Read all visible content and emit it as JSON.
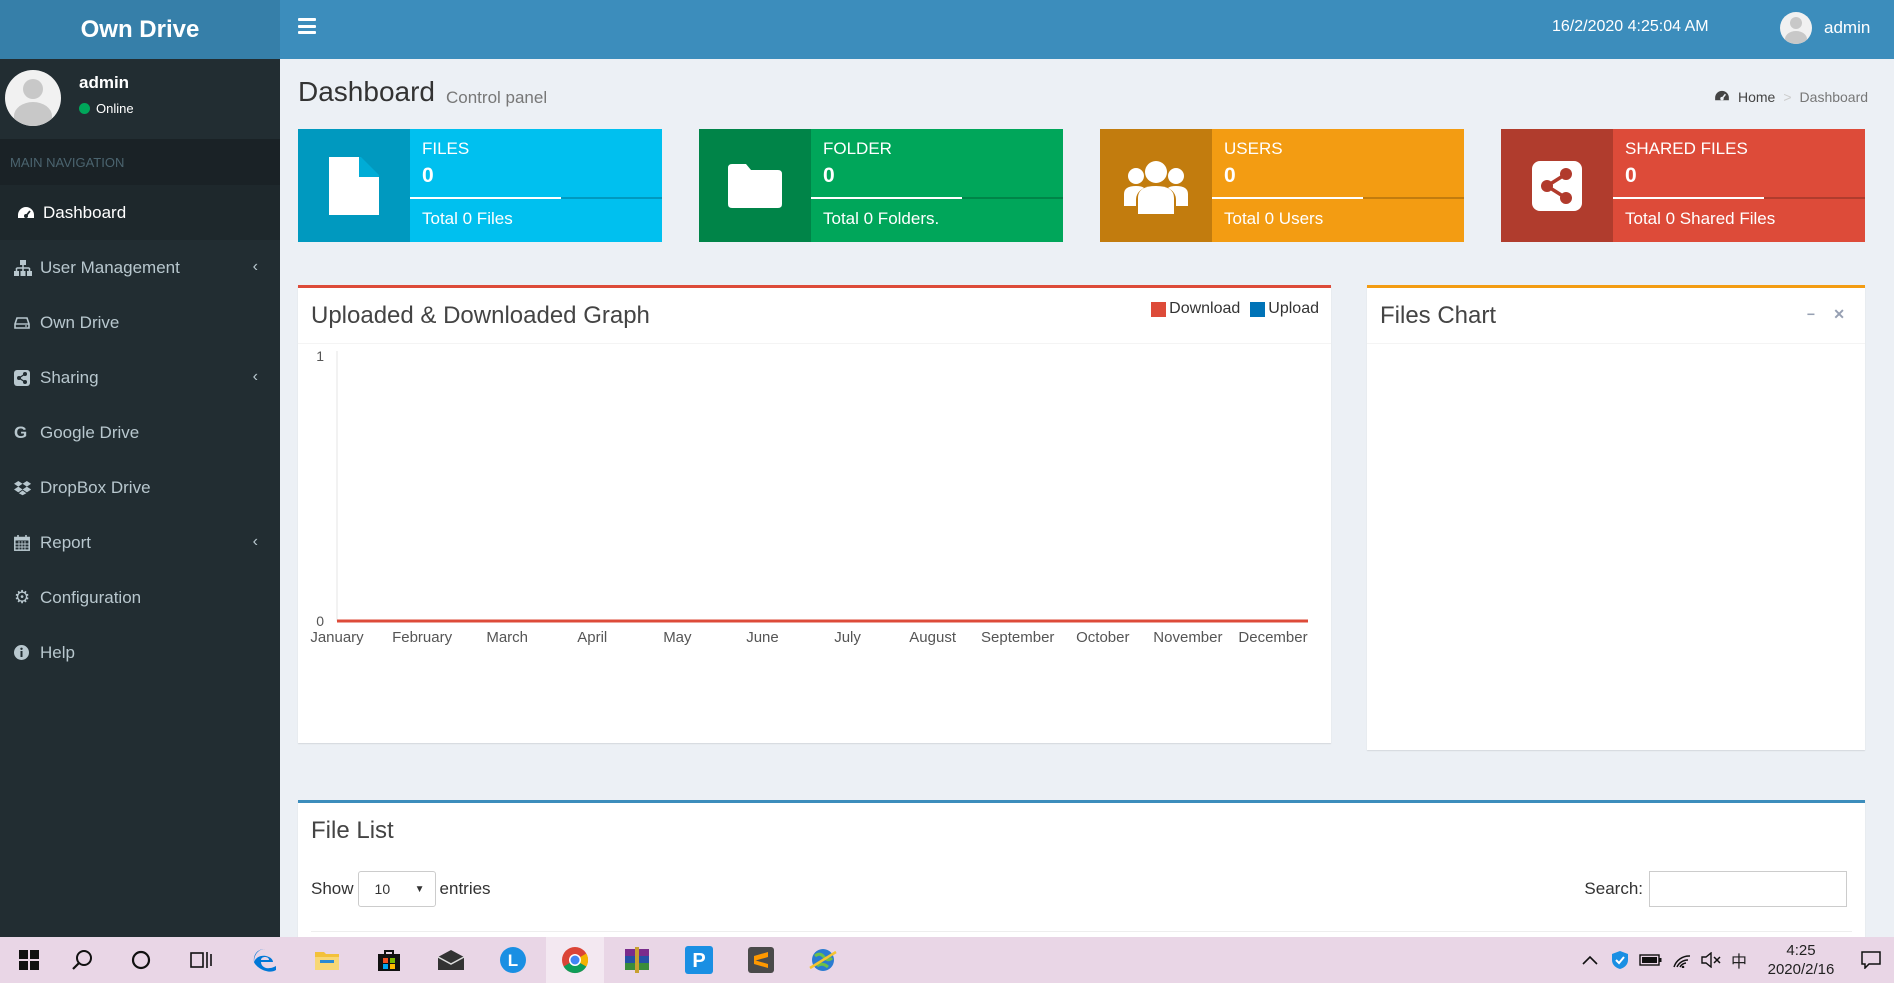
{
  "app": {
    "logo": "Own Drive"
  },
  "header": {
    "datetime": "16/2/2020 4:25:04 AM",
    "user": "admin"
  },
  "sidebar": {
    "user_name": "admin",
    "status": "Online",
    "nav_header": "MAIN NAVIGATION",
    "items": [
      {
        "label": "Dashboard",
        "icon": "dashboard-icon"
      },
      {
        "label": "User Management",
        "icon": "sitemap-icon"
      },
      {
        "label": "Own Drive",
        "icon": "hdd-icon"
      },
      {
        "label": "Sharing",
        "icon": "share-square-icon"
      },
      {
        "label": "Google Drive",
        "icon": "google-icon"
      },
      {
        "label": "DropBox Drive",
        "icon": "dropbox-icon"
      },
      {
        "label": "Report",
        "icon": "calendar-icon"
      },
      {
        "label": "Configuration",
        "icon": "gear-icon"
      },
      {
        "label": "Help",
        "icon": "info-circle-icon"
      }
    ]
  },
  "page": {
    "title": "Dashboard",
    "subtitle": "Control panel"
  },
  "breadcrumb": {
    "home": "Home",
    "current": "Dashboard"
  },
  "info_boxes": [
    {
      "label": "FILES",
      "value": "0",
      "desc": "Total 0 Files",
      "color": "#00c0ef",
      "icon": "file-icon"
    },
    {
      "label": "FOLDER",
      "value": "0",
      "desc": "Total 0 Folders.",
      "color": "#00a65a",
      "icon": "folder-icon"
    },
    {
      "label": "USERS",
      "value": "0",
      "desc": "Total 0 Users",
      "color": "#f39c12",
      "icon": "users-icon"
    },
    {
      "label": "SHARED FILES",
      "value": "0",
      "desc": "Total 0 Shared Files",
      "color": "#dd4b39",
      "icon": "share-icon"
    }
  ],
  "graph_panel": {
    "title": "Uploaded & Downloaded Graph",
    "accent": "#dd4b39"
  },
  "files_chart_panel": {
    "title": "Files Chart",
    "accent": "#f39c12"
  },
  "file_list": {
    "title": "File List",
    "show_label": "Show",
    "entries_value": "10",
    "entries_label": "entries",
    "search_label": "Search:",
    "accent": "#3c8dbc"
  },
  "chart_data": {
    "type": "line",
    "categories": [
      "January",
      "February",
      "March",
      "April",
      "May",
      "June",
      "July",
      "August",
      "September",
      "October",
      "November",
      "December"
    ],
    "series": [
      {
        "name": "Download",
        "color": "#dd4b39",
        "values": [
          0,
          0,
          0,
          0,
          0,
          0,
          0,
          0,
          0,
          0,
          0,
          0
        ]
      },
      {
        "name": "Upload",
        "color": "#0073b7",
        "values": [
          0,
          0,
          0,
          0,
          0,
          0,
          0,
          0,
          0,
          0,
          0,
          0
        ]
      }
    ],
    "yticks": [
      "0",
      "1"
    ],
    "ylim": [
      0,
      1
    ],
    "legend_position": "top-right"
  },
  "taskbar": {
    "time": "4:25",
    "date": "2020/2/16",
    "ime": "中",
    "apps": [
      "windows-start-icon",
      "search-icon",
      "cortana-icon",
      "task-view-icon",
      "edge-icon",
      "file-explorer-icon",
      "store-icon",
      "mail-icon",
      "app-l-icon",
      "chrome-icon",
      "winrar-icon",
      "app-p-icon",
      "sublime-icon",
      "network-globe-icon"
    ]
  }
}
